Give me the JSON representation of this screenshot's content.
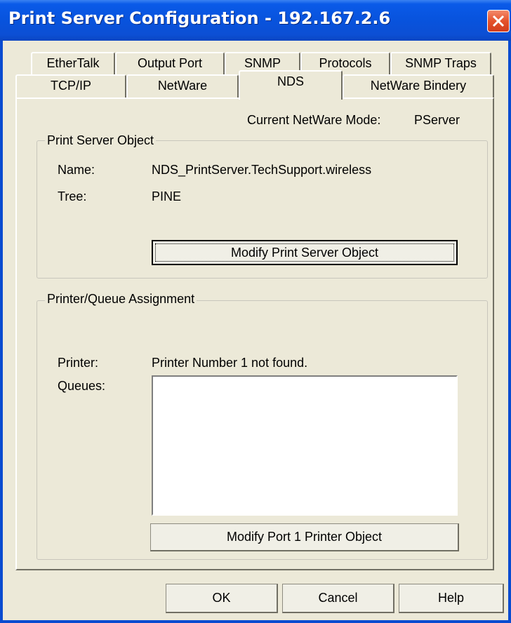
{
  "window": {
    "title": "Print Server Configuration - 192.167.2.6"
  },
  "tabs": {
    "row1": [
      "EtherTalk",
      "Output Port",
      "SNMP",
      "Protocols",
      "SNMP Traps"
    ],
    "row2": [
      "TCP/IP",
      "NetWare",
      "NDS",
      "NetWare Bindery"
    ],
    "active": "NDS"
  },
  "mode": {
    "label": "Current NetWare Mode:",
    "value": "PServer"
  },
  "print_server": {
    "group_label": "Print Server Object",
    "name_label": "Name:",
    "name_value": "NDS_PrintServer.TechSupport.wireless",
    "tree_label": "Tree:",
    "tree_value": "PINE",
    "modify_button": "Modify Print Server Object"
  },
  "printer_queue": {
    "group_label": "Printer/Queue Assignment",
    "printer_label": "Printer:",
    "printer_value": "Printer Number 1 not found.",
    "queues_label": "Queues:",
    "queues": [],
    "modify_button": "Modify Port 1 Printer Object"
  },
  "footer": {
    "ok": "OK",
    "cancel": "Cancel",
    "help": "Help"
  },
  "colors": {
    "titlebar": "#0a5ae8",
    "dialog_bg": "#ece9d8",
    "close_button": "#e5532d"
  }
}
